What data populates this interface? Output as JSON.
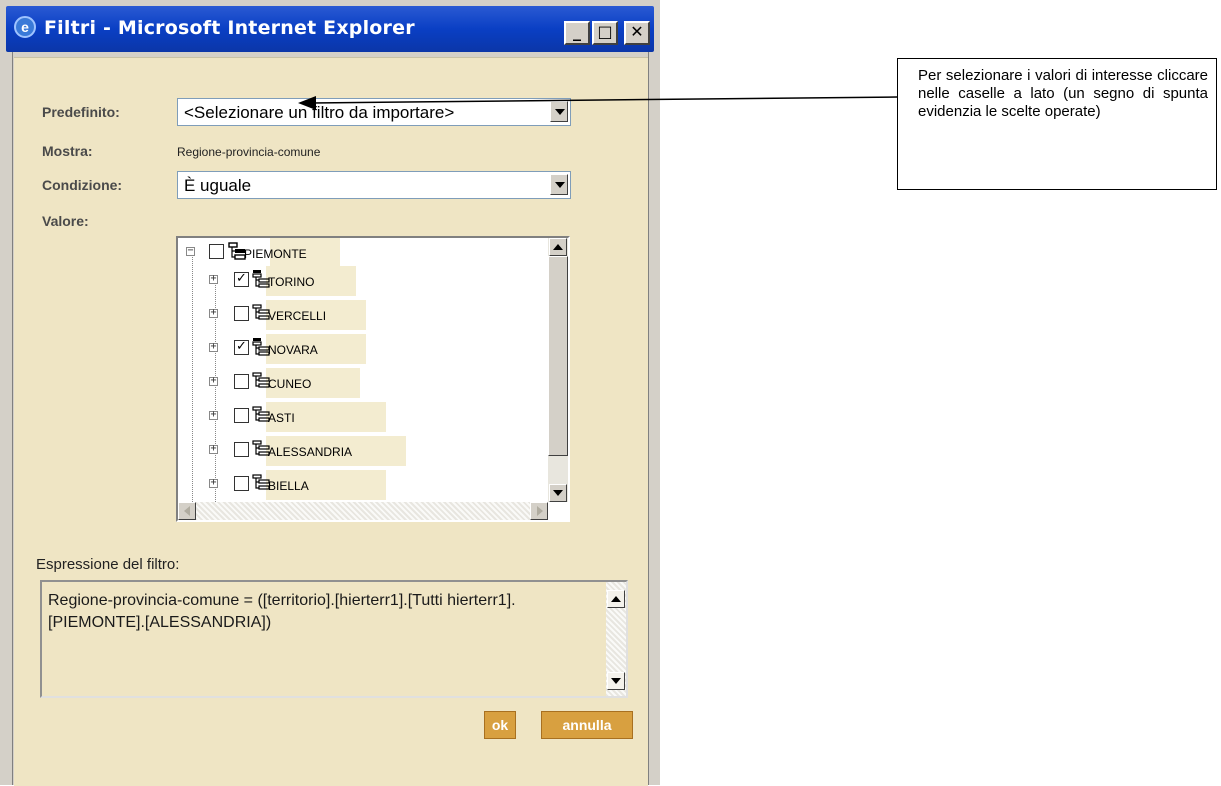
{
  "window": {
    "title": "Filtri - Microsoft Internet Explorer",
    "title_icon": "ie-icon",
    "controls": [
      "minimize-icon",
      "maximize-icon",
      "close-icon"
    ]
  },
  "form": {
    "predefinito_label": "Predefinito:",
    "predefinito_value": "<Selezionare un filtro da importare>",
    "mostra_label": "Mostra:",
    "mostra_value": "Regione-provincia-comune",
    "condizione_label": "Condizione:",
    "condizione_value": "È uguale",
    "valore_label": "Valore:"
  },
  "tree": {
    "root": {
      "label": "PIEMONTE",
      "checked": false,
      "expanded": true
    },
    "children": [
      {
        "label": "TORINO",
        "checked": true
      },
      {
        "label": "VERCELLI",
        "checked": false
      },
      {
        "label": "NOVARA",
        "checked": true
      },
      {
        "label": "CUNEO",
        "checked": false
      },
      {
        "label": "ASTI",
        "checked": false
      },
      {
        "label": "ALESSANDRIA",
        "checked": false
      },
      {
        "label": "BIELLA",
        "checked": false
      }
    ]
  },
  "expression": {
    "label": "Espressione del filtro:",
    "text": "Regione-provincia-comune = ([territorio].[hierterr1].[Tutti hierterr1].[PIEMONTE].[ALESSANDRIA])"
  },
  "buttons": {
    "ok": "ok",
    "annulla": "annulla"
  },
  "callout": {
    "text": "Per selezionare i valori di interesse cliccare nelle caselle a lato (un segno di spunta evidenzia le scelte operate)"
  },
  "colors": {
    "titlebar": "#0a3fc4",
    "content_bg": "#efe5c4",
    "label_text": "#4a4a4a",
    "action_button": "#d8a040"
  }
}
